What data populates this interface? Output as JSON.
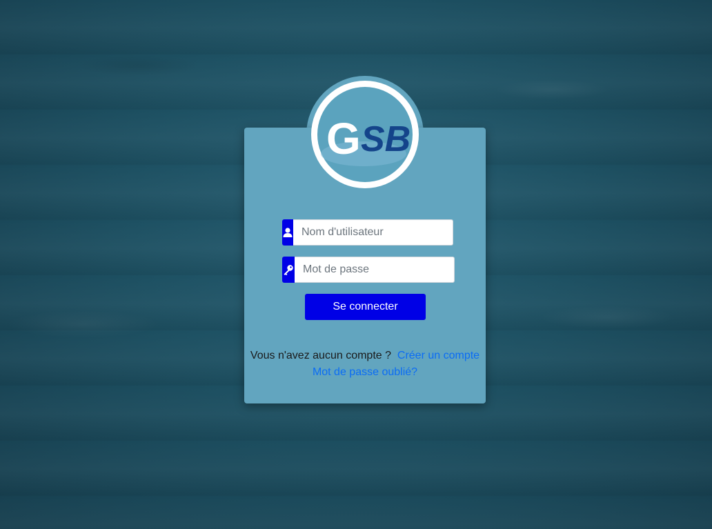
{
  "logo": {
    "text_g": "G",
    "text_sb": "SB",
    "alt": "GSB"
  },
  "form": {
    "username_placeholder": "Nom d'utilisateur",
    "password_placeholder": "Mot de passe",
    "submit_label": "Se connecter"
  },
  "footer": {
    "no_account_text": "Vous n'avez aucun compte ?",
    "create_account_link": "Créer un compte",
    "forgot_password_link": "Mot de passe oublié?"
  },
  "colors": {
    "card": "#62a5bf",
    "primary": "#0000e6",
    "link": "#0b6cf5",
    "background": "#1d5062"
  },
  "icons": {
    "username": "user-icon",
    "password": "key-icon"
  }
}
